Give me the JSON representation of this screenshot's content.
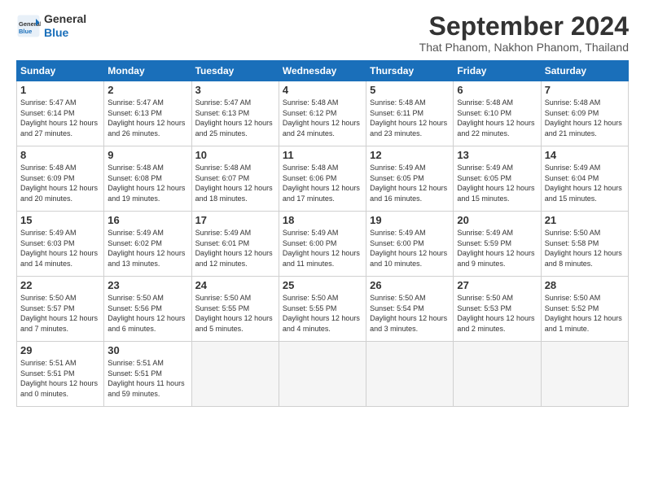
{
  "logo": {
    "line1": "General",
    "line2": "Blue"
  },
  "title": "September 2024",
  "subtitle": "That Phanom, Nakhon Phanom, Thailand",
  "headers": [
    "Sunday",
    "Monday",
    "Tuesday",
    "Wednesday",
    "Thursday",
    "Friday",
    "Saturday"
  ],
  "weeks": [
    [
      {
        "day": "1",
        "rise": "5:47 AM",
        "set": "6:14 PM",
        "daylight": "12 hours and 27 minutes."
      },
      {
        "day": "2",
        "rise": "5:47 AM",
        "set": "6:13 PM",
        "daylight": "12 hours and 26 minutes."
      },
      {
        "day": "3",
        "rise": "5:47 AM",
        "set": "6:13 PM",
        "daylight": "12 hours and 25 minutes."
      },
      {
        "day": "4",
        "rise": "5:48 AM",
        "set": "6:12 PM",
        "daylight": "12 hours and 24 minutes."
      },
      {
        "day": "5",
        "rise": "5:48 AM",
        "set": "6:11 PM",
        "daylight": "12 hours and 23 minutes."
      },
      {
        "day": "6",
        "rise": "5:48 AM",
        "set": "6:10 PM",
        "daylight": "12 hours and 22 minutes."
      },
      {
        "day": "7",
        "rise": "5:48 AM",
        "set": "6:09 PM",
        "daylight": "12 hours and 21 minutes."
      }
    ],
    [
      {
        "day": "8",
        "rise": "5:48 AM",
        "set": "6:09 PM",
        "daylight": "12 hours and 20 minutes."
      },
      {
        "day": "9",
        "rise": "5:48 AM",
        "set": "6:08 PM",
        "daylight": "12 hours and 19 minutes."
      },
      {
        "day": "10",
        "rise": "5:48 AM",
        "set": "6:07 PM",
        "daylight": "12 hours and 18 minutes."
      },
      {
        "day": "11",
        "rise": "5:48 AM",
        "set": "6:06 PM",
        "daylight": "12 hours and 17 minutes."
      },
      {
        "day": "12",
        "rise": "5:49 AM",
        "set": "6:05 PM",
        "daylight": "12 hours and 16 minutes."
      },
      {
        "day": "13",
        "rise": "5:49 AM",
        "set": "6:05 PM",
        "daylight": "12 hours and 15 minutes."
      },
      {
        "day": "14",
        "rise": "5:49 AM",
        "set": "6:04 PM",
        "daylight": "12 hours and 15 minutes."
      }
    ],
    [
      {
        "day": "15",
        "rise": "5:49 AM",
        "set": "6:03 PM",
        "daylight": "12 hours and 14 minutes."
      },
      {
        "day": "16",
        "rise": "5:49 AM",
        "set": "6:02 PM",
        "daylight": "12 hours and 13 minutes."
      },
      {
        "day": "17",
        "rise": "5:49 AM",
        "set": "6:01 PM",
        "daylight": "12 hours and 12 minutes."
      },
      {
        "day": "18",
        "rise": "5:49 AM",
        "set": "6:00 PM",
        "daylight": "12 hours and 11 minutes."
      },
      {
        "day": "19",
        "rise": "5:49 AM",
        "set": "6:00 PM",
        "daylight": "12 hours and 10 minutes."
      },
      {
        "day": "20",
        "rise": "5:49 AM",
        "set": "5:59 PM",
        "daylight": "12 hours and 9 minutes."
      },
      {
        "day": "21",
        "rise": "5:50 AM",
        "set": "5:58 PM",
        "daylight": "12 hours and 8 minutes."
      }
    ],
    [
      {
        "day": "22",
        "rise": "5:50 AM",
        "set": "5:57 PM",
        "daylight": "12 hours and 7 minutes."
      },
      {
        "day": "23",
        "rise": "5:50 AM",
        "set": "5:56 PM",
        "daylight": "12 hours and 6 minutes."
      },
      {
        "day": "24",
        "rise": "5:50 AM",
        "set": "5:55 PM",
        "daylight": "12 hours and 5 minutes."
      },
      {
        "day": "25",
        "rise": "5:50 AM",
        "set": "5:55 PM",
        "daylight": "12 hours and 4 minutes."
      },
      {
        "day": "26",
        "rise": "5:50 AM",
        "set": "5:54 PM",
        "daylight": "12 hours and 3 minutes."
      },
      {
        "day": "27",
        "rise": "5:50 AM",
        "set": "5:53 PM",
        "daylight": "12 hours and 2 minutes."
      },
      {
        "day": "28",
        "rise": "5:50 AM",
        "set": "5:52 PM",
        "daylight": "12 hours and 1 minute."
      }
    ],
    [
      {
        "day": "29",
        "rise": "5:51 AM",
        "set": "5:51 PM",
        "daylight": "12 hours and 0 minutes."
      },
      {
        "day": "30",
        "rise": "5:51 AM",
        "set": "5:51 PM",
        "daylight": "11 hours and 59 minutes."
      },
      null,
      null,
      null,
      null,
      null
    ]
  ]
}
